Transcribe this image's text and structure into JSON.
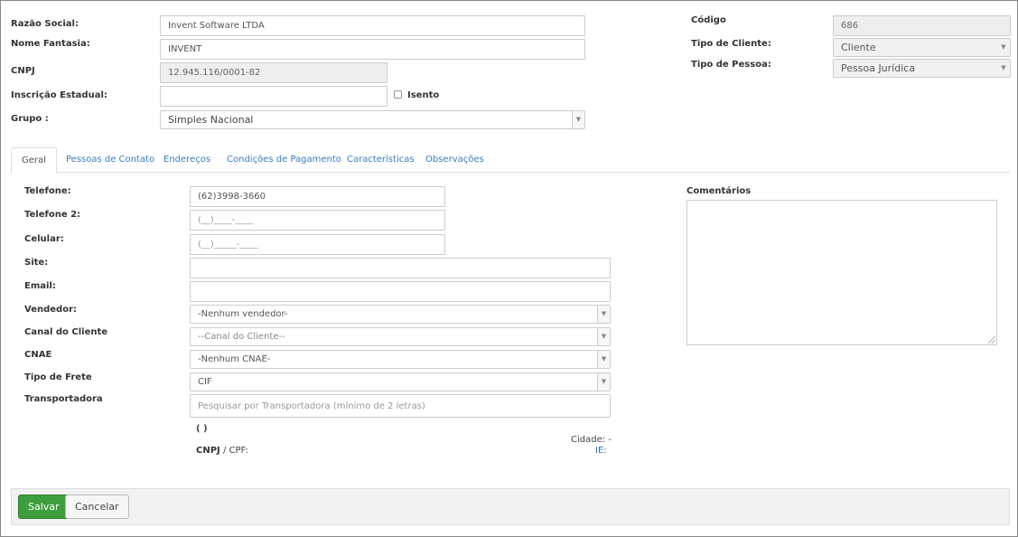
{
  "header": {
    "razao_social": {
      "label": "Razão Social:",
      "value": "Invent Software LTDA"
    },
    "nome_fantasia": {
      "label": "Nome Fantasia:",
      "value": "INVENT"
    },
    "cnpj": {
      "label": "CNPJ",
      "value": "12.945.116/0001-82"
    },
    "inscricao_estadual": {
      "label": "Inscrição Estadual:",
      "value": "",
      "isento_label": "Isento"
    },
    "grupo": {
      "label": "Grupo :",
      "value": "Simples Nacional"
    },
    "codigo": {
      "label": "Código",
      "value": "686"
    },
    "tipo_cliente": {
      "label": "Tipo de Cliente:",
      "value": "Cliente"
    },
    "tipo_pessoa": {
      "label": "Tipo de Pessoa:",
      "value": "Pessoa Jurídica"
    }
  },
  "tabs": [
    {
      "label": "Geral",
      "active": true
    },
    {
      "label": "Pessoas de Contato"
    },
    {
      "label": "Endereços"
    },
    {
      "label": "Condições de Pagamento"
    },
    {
      "label": "Características"
    },
    {
      "label": "Observações"
    }
  ],
  "geral": {
    "telefone": {
      "label": "Telefone:",
      "value": "(62)3998-3660"
    },
    "telefone2": {
      "label": "Telefone 2:",
      "placeholder": "(__)____-____"
    },
    "celular": {
      "label": "Celular:",
      "placeholder": "(__)_____-____"
    },
    "site": {
      "label": "Site:",
      "value": ""
    },
    "email": {
      "label": "Email:",
      "value": ""
    },
    "vendedor": {
      "label": "Vendedor:",
      "value": "-Nenhum vendedor-"
    },
    "canal": {
      "label": "Canal do Cliente",
      "value": "--Canal do Cliente--"
    },
    "cnae": {
      "label": "CNAE",
      "value": "-Nenhum CNAE-"
    },
    "tipo_frete": {
      "label": "Tipo de Frete",
      "value": "CIF"
    },
    "transportadora": {
      "label": "Transportadora",
      "placeholder": "Pesquisar por Transportadora (mínimo de 2 letras)"
    },
    "transp_info": {
      "name": "( )",
      "cnpj_label": "CNPJ",
      "cpf_label": " / CPF:",
      "cidade": "Cidade: -",
      "ie": "IE:"
    },
    "comentarios": {
      "label": "Comentários"
    }
  },
  "footer": {
    "save_label": "Salvar",
    "cancel_label": "Cancelar"
  },
  "colors": {
    "accent": "#3a7cbf",
    "save": "#3e9e3e"
  },
  "icons": {
    "select_arrow": "chevron-down-icon"
  }
}
